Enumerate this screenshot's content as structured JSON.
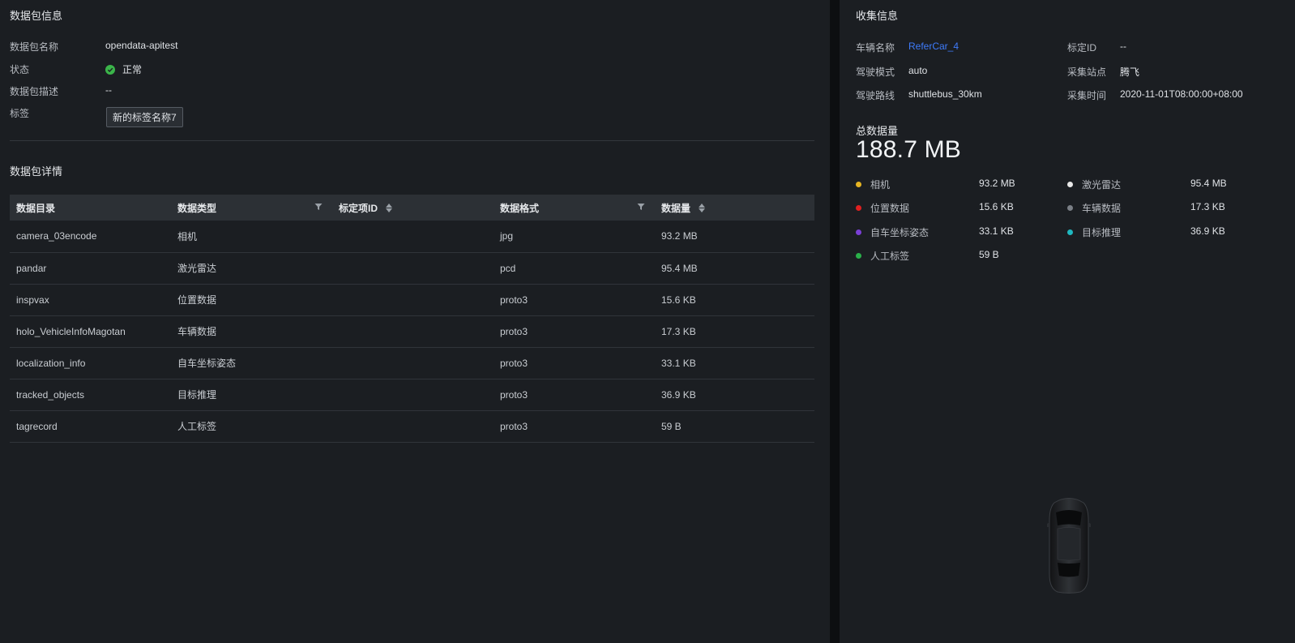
{
  "package_info": {
    "title": "数据包信息",
    "name_label": "数据包名称",
    "name_value": "opendata-apitest",
    "status_label": "状态",
    "status_value": "正常",
    "desc_label": "数据包描述",
    "desc_value": "--",
    "tag_label": "标签",
    "tag_value": "新的标签名称7"
  },
  "package_details": {
    "title": "数据包详情",
    "columns": [
      "数据目录",
      "数据类型",
      "标定项ID",
      "数据格式",
      "数据量"
    ],
    "rows": [
      [
        "camera_03encode",
        "相机",
        "",
        "jpg",
        "93.2 MB"
      ],
      [
        "pandar",
        "激光雷达",
        "",
        "pcd",
        "95.4 MB"
      ],
      [
        "inspvax",
        "位置数据",
        "",
        "proto3",
        "15.6 KB"
      ],
      [
        "holo_VehicleInfoMagotan",
        "车辆数据",
        "",
        "proto3",
        "17.3 KB"
      ],
      [
        "localization_info",
        "自车坐标姿态",
        "",
        "proto3",
        "33.1 KB"
      ],
      [
        "tracked_objects",
        "目标推理",
        "",
        "proto3",
        "36.9 KB"
      ],
      [
        "tagrecord",
        "人工标签",
        "",
        "proto3",
        "59 B"
      ]
    ]
  },
  "collect_info": {
    "title": "收集信息",
    "vehicle_label": "车辆名称",
    "vehicle_value": "ReferCar_4",
    "calib_label": "标定ID",
    "calib_value": "--",
    "mode_label": "驾驶模式",
    "mode_value": "auto",
    "site_label": "采集站点",
    "site_value": "腾飞",
    "route_label": "驾驶路线",
    "route_value": "shuttlebus_30km",
    "time_label": "采集时间",
    "time_value": "2020-11-01T08:00:00+08:00"
  },
  "total": {
    "label": "总数据量",
    "value": "188.7 MB"
  },
  "legend": [
    {
      "name": "相机",
      "value": "93.2 MB",
      "color": "#e6b422"
    },
    {
      "name": "激光雷达",
      "value": "95.4 MB",
      "color": "#e8e8e8"
    },
    {
      "name": "位置数据",
      "value": "15.6 KB",
      "color": "#e02020"
    },
    {
      "name": "车辆数据",
      "value": "17.3 KB",
      "color": "#7a7f86"
    },
    {
      "name": "自车坐标姿态",
      "value": "33.1 KB",
      "color": "#7a3fd6"
    },
    {
      "name": "目标推理",
      "value": "36.9 KB",
      "color": "#1fb8c0"
    },
    {
      "name": "人工标签",
      "value": "59 B",
      "color": "#2ab04a"
    }
  ],
  "icons": {
    "status": "check-circle-icon",
    "filter": "filter-icon",
    "sort": "sort-icon",
    "vehicle": "car-top-view-icon"
  }
}
